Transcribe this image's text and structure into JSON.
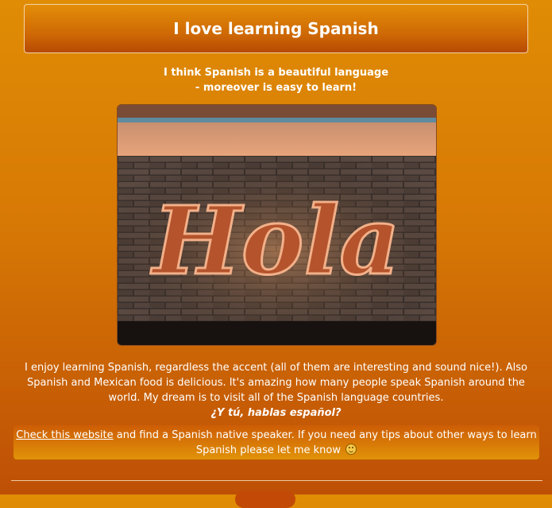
{
  "header": {
    "title": "I love learning Spanish"
  },
  "subtitle": {
    "line1": "I think Spanish is a beautiful language",
    "line2": "- moreover is easy to learn!"
  },
  "image": {
    "sign_text": "Hola"
  },
  "body": {
    "paragraph": "I enjoy learning Spanish, regardless the accent (all of them are interesting and sound nice!). Also Spanish and Mexican food is delicious. It's amazing how many people speak Spanish around the world. My dream is to visit all of the Spanish language countries.",
    "question": "¿Y tú, hablas español?"
  },
  "info": {
    "link_text": "Check this website",
    "text": " and find a Spanish native speaker. If you need any tips about other ways to learn Spanish please let me know ",
    "emoji_icon": "smiley-icon"
  },
  "colors": {
    "background_top": "#e08c05",
    "background_bottom": "#be5006",
    "text": "#ffffff"
  }
}
